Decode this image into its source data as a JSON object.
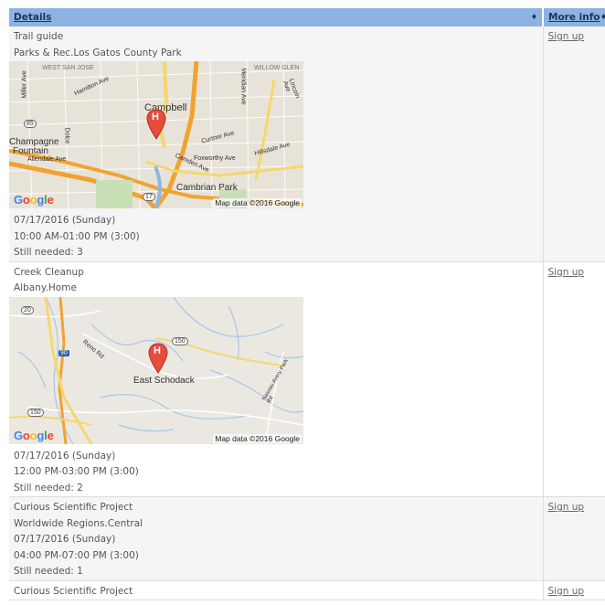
{
  "header": {
    "details_label": "Details",
    "more_info_label": "More info",
    "sort_glyph": "♦"
  },
  "maps": {
    "credit": "Map data ©2016 Google",
    "logo_letters": [
      "G",
      "o",
      "o",
      "g",
      "l",
      "e"
    ],
    "pin_letter": "H"
  },
  "rows": [
    {
      "title": "Trail guide",
      "location": "Parks & Rec.Los Gatos County Park",
      "map_labels": {
        "campbell": "Campbell",
        "west_san_jose": "WEST SAN JOSE",
        "willow_glen": "WILLOW GLEN",
        "hamilton": "Hamilton Ave",
        "champagne": "Champagne",
        "fountain": "Fountain",
        "allendale": "Allendale Ave",
        "curtner": "Curtner Ave",
        "foxworthy": "Foxworthy Ave",
        "hillsdale": "Hillsdale Ave",
        "camden": "Camden Ave",
        "cambrian": "Cambrian Park",
        "miller": "Miller Ave",
        "meridian": "Meridian Ave",
        "lincoln": "Lincoln Ave",
        "dolce": "Dolce",
        "shield_85": "85",
        "shield_17": "17"
      },
      "date": "07/17/2016 (Sunday)",
      "time": "10:00 AM-01:00 PM (3:00)",
      "needed": "Still needed: 3",
      "signup": "Sign up"
    },
    {
      "title": "Creek Cleanup",
      "location": "Albany.Home",
      "map_labels": {
        "east_schodack": "East Schodack",
        "reno_rd": "Reno Rd",
        "nassau": "Nassau Avery Park Rd",
        "shield_20": "20",
        "shield_90": "90",
        "shield_150a": "150",
        "shield_150b": "150"
      },
      "date": "07/17/2016 (Sunday)",
      "time": "12:00 PM-03:00 PM (3:00)",
      "needed": "Still needed: 2",
      "signup": "Sign up"
    },
    {
      "title": "Curious Scientific Project",
      "location": "Worldwide Regions.Central",
      "date": "07/17/2016 (Sunday)",
      "time": "04:00 PM-07:00 PM (3:00)",
      "needed": "Still needed: 1",
      "signup": "Sign up"
    },
    {
      "title": "Curious Scientific Project",
      "signup": "Sign up"
    }
  ]
}
